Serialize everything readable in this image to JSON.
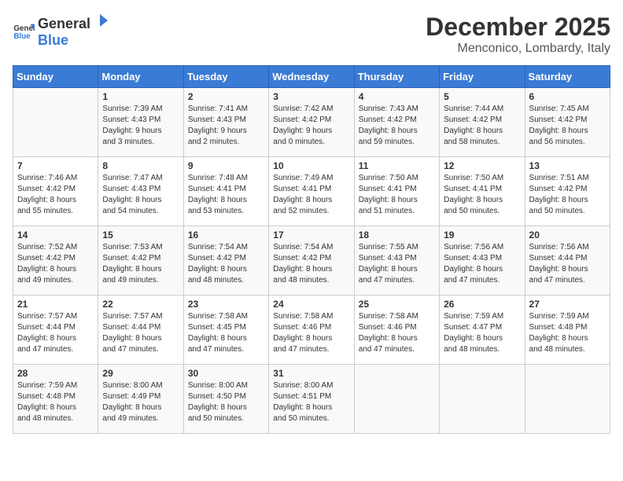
{
  "logo": {
    "text_general": "General",
    "text_blue": "Blue"
  },
  "title": "December 2025",
  "subtitle": "Menconico, Lombardy, Italy",
  "days_header": [
    "Sunday",
    "Monday",
    "Tuesday",
    "Wednesday",
    "Thursday",
    "Friday",
    "Saturday"
  ],
  "weeks": [
    [
      {
        "day": "",
        "info": ""
      },
      {
        "day": "1",
        "info": "Sunrise: 7:39 AM\nSunset: 4:43 PM\nDaylight: 9 hours\nand 3 minutes."
      },
      {
        "day": "2",
        "info": "Sunrise: 7:41 AM\nSunset: 4:43 PM\nDaylight: 9 hours\nand 2 minutes."
      },
      {
        "day": "3",
        "info": "Sunrise: 7:42 AM\nSunset: 4:42 PM\nDaylight: 9 hours\nand 0 minutes."
      },
      {
        "day": "4",
        "info": "Sunrise: 7:43 AM\nSunset: 4:42 PM\nDaylight: 8 hours\nand 59 minutes."
      },
      {
        "day": "5",
        "info": "Sunrise: 7:44 AM\nSunset: 4:42 PM\nDaylight: 8 hours\nand 58 minutes."
      },
      {
        "day": "6",
        "info": "Sunrise: 7:45 AM\nSunset: 4:42 PM\nDaylight: 8 hours\nand 56 minutes."
      }
    ],
    [
      {
        "day": "7",
        "info": "Sunrise: 7:46 AM\nSunset: 4:42 PM\nDaylight: 8 hours\nand 55 minutes."
      },
      {
        "day": "8",
        "info": "Sunrise: 7:47 AM\nSunset: 4:43 PM\nDaylight: 8 hours\nand 54 minutes."
      },
      {
        "day": "9",
        "info": "Sunrise: 7:48 AM\nSunset: 4:41 PM\nDaylight: 8 hours\nand 53 minutes."
      },
      {
        "day": "10",
        "info": "Sunrise: 7:49 AM\nSunset: 4:41 PM\nDaylight: 8 hours\nand 52 minutes."
      },
      {
        "day": "11",
        "info": "Sunrise: 7:50 AM\nSunset: 4:41 PM\nDaylight: 8 hours\nand 51 minutes."
      },
      {
        "day": "12",
        "info": "Sunrise: 7:50 AM\nSunset: 4:41 PM\nDaylight: 8 hours\nand 50 minutes."
      },
      {
        "day": "13",
        "info": "Sunrise: 7:51 AM\nSunset: 4:42 PM\nDaylight: 8 hours\nand 50 minutes."
      }
    ],
    [
      {
        "day": "14",
        "info": "Sunrise: 7:52 AM\nSunset: 4:42 PM\nDaylight: 8 hours\nand 49 minutes."
      },
      {
        "day": "15",
        "info": "Sunrise: 7:53 AM\nSunset: 4:42 PM\nDaylight: 8 hours\nand 49 minutes."
      },
      {
        "day": "16",
        "info": "Sunrise: 7:54 AM\nSunset: 4:42 PM\nDaylight: 8 hours\nand 48 minutes."
      },
      {
        "day": "17",
        "info": "Sunrise: 7:54 AM\nSunset: 4:42 PM\nDaylight: 8 hours\nand 48 minutes."
      },
      {
        "day": "18",
        "info": "Sunrise: 7:55 AM\nSunset: 4:43 PM\nDaylight: 8 hours\nand 47 minutes."
      },
      {
        "day": "19",
        "info": "Sunrise: 7:56 AM\nSunset: 4:43 PM\nDaylight: 8 hours\nand 47 minutes."
      },
      {
        "day": "20",
        "info": "Sunrise: 7:56 AM\nSunset: 4:44 PM\nDaylight: 8 hours\nand 47 minutes."
      }
    ],
    [
      {
        "day": "21",
        "info": "Sunrise: 7:57 AM\nSunset: 4:44 PM\nDaylight: 8 hours\nand 47 minutes."
      },
      {
        "day": "22",
        "info": "Sunrise: 7:57 AM\nSunset: 4:44 PM\nDaylight: 8 hours\nand 47 minutes."
      },
      {
        "day": "23",
        "info": "Sunrise: 7:58 AM\nSunset: 4:45 PM\nDaylight: 8 hours\nand 47 minutes."
      },
      {
        "day": "24",
        "info": "Sunrise: 7:58 AM\nSunset: 4:46 PM\nDaylight: 8 hours\nand 47 minutes."
      },
      {
        "day": "25",
        "info": "Sunrise: 7:58 AM\nSunset: 4:46 PM\nDaylight: 8 hours\nand 47 minutes."
      },
      {
        "day": "26",
        "info": "Sunrise: 7:59 AM\nSunset: 4:47 PM\nDaylight: 8 hours\nand 48 minutes."
      },
      {
        "day": "27",
        "info": "Sunrise: 7:59 AM\nSunset: 4:48 PM\nDaylight: 8 hours\nand 48 minutes."
      }
    ],
    [
      {
        "day": "28",
        "info": "Sunrise: 7:59 AM\nSunset: 4:48 PM\nDaylight: 8 hours\nand 48 minutes."
      },
      {
        "day": "29",
        "info": "Sunrise: 8:00 AM\nSunset: 4:49 PM\nDaylight: 8 hours\nand 49 minutes."
      },
      {
        "day": "30",
        "info": "Sunrise: 8:00 AM\nSunset: 4:50 PM\nDaylight: 8 hours\nand 50 minutes."
      },
      {
        "day": "31",
        "info": "Sunrise: 8:00 AM\nSunset: 4:51 PM\nDaylight: 8 hours\nand 50 minutes."
      },
      {
        "day": "",
        "info": ""
      },
      {
        "day": "",
        "info": ""
      },
      {
        "day": "",
        "info": ""
      }
    ]
  ]
}
